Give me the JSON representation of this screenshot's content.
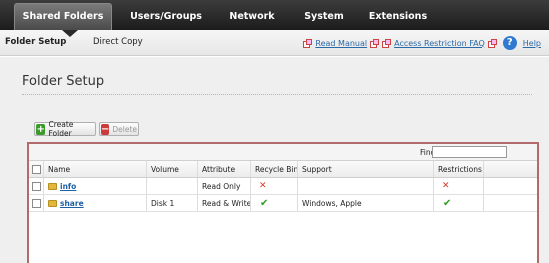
{
  "top_nav": {
    "tabs": [
      {
        "label": "Shared Folders"
      },
      {
        "label": "Users/Groups"
      },
      {
        "label": "Network"
      },
      {
        "label": "System"
      },
      {
        "label": "Extensions"
      }
    ]
  },
  "sub_nav": {
    "items": [
      {
        "label": "Folder Setup"
      },
      {
        "label": "Direct Copy"
      }
    ],
    "read_manual": "Read Manual",
    "access_faq": "Access Restriction FAQ",
    "help_glyph": "?",
    "help": "Help"
  },
  "page": {
    "title": "Folder Setup",
    "buttons": {
      "create_icon": "+",
      "create": "Create Folder",
      "delete_icon": "−",
      "delete": "Delete"
    }
  },
  "grid": {
    "find_label": "Find",
    "find_value": "",
    "columns": [
      "Name",
      "Volume",
      "Attribute",
      "Recycle Bin",
      "Support",
      "Restrictions"
    ],
    "rows": [
      {
        "name": "info",
        "volume": "",
        "attribute": "Read Only",
        "recycle_bin": "✕",
        "support": "",
        "restrictions": "✕"
      },
      {
        "name": "share",
        "volume": "Disk 1",
        "attribute": "Read & Write",
        "recycle_bin": "✔",
        "support": "Windows, Apple",
        "restrictions": "✔"
      }
    ]
  },
  "colors": {
    "nav_bg": "#1c1c1c",
    "link": "#2a6aa8",
    "grid_border": "#b26a6a",
    "no_mark": "#d23a2a",
    "yes_mark": "#2f9a25"
  }
}
